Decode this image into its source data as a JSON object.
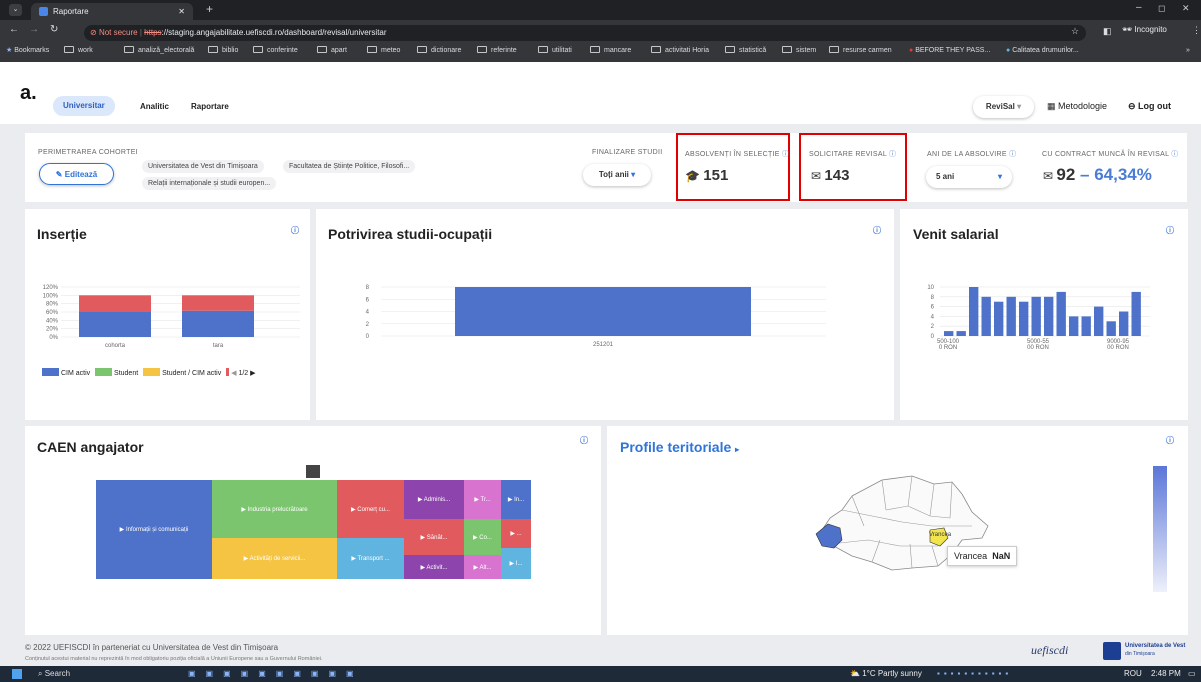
{
  "browser": {
    "tab_title": "Raportare",
    "url_warning": "Not secure",
    "url_scheme": "https",
    "url_rest": "://staging.angajabilitate.uefiscdi.ro/dashboard/revisal/universitar",
    "incognito_label": "Incognito",
    "bookmarks": [
      "Bookmarks",
      "work",
      "analiză_electorală",
      "biblio",
      "conferinte",
      "apart",
      "meteo",
      "dictionare",
      "referinte",
      "utilitati",
      "mancare",
      "activitati Horia",
      "statistică",
      "sistem",
      "resurse carmen",
      "BEFORE THEY PASS...",
      "Calitatea drumurilor..."
    ]
  },
  "nav": {
    "logo": "a.",
    "items": [
      "Universitar",
      "Analitic",
      "Raportare"
    ],
    "revisal_btn": "ReviSal",
    "metodologie": "Metodologie",
    "logout": "Log out"
  },
  "filters": {
    "cohort_title": "PERIMETRAREA COHORTEI",
    "edit_btn": "Editează",
    "tags": [
      "Universitatea de Vest din Timișoara",
      "Facultatea de Științe Politice, Filosofi...",
      "Relații internaționale și studii europen..."
    ],
    "finalizare_label": "FINALIZARE STUDII",
    "finalizare_value": "Toți anii",
    "absolventi_label": "ABSOLVENȚI ÎN SELECȚIE",
    "absolventi_value": "151",
    "solicitare_label": "SOLICITARE REVISAL",
    "solicitare_value": "143",
    "ani_label": "ANI DE LA ABSOLVIRE",
    "ani_value": "5 ani",
    "contract_label": "CU CONTRACT MUNCĂ ÎN REVISAL",
    "contract_value": "92",
    "contract_pct": "– 64,34%"
  },
  "colors": {
    "blue": "#4e71c9",
    "red": "#e05a5e",
    "green": "#7cc56f",
    "yellow": "#f5c443",
    "purple": "#8e44ad",
    "pink": "#d973d0",
    "cyan": "#5fb5e0",
    "accent": "#2f74d8"
  },
  "insertie": {
    "title": "Inserție",
    "chart_data": {
      "type": "bar",
      "stacked": true,
      "categories": [
        "cohorta",
        "tara"
      ],
      "ylim": [
        0,
        120
      ],
      "yticks": [
        "120%",
        "100%",
        "80%",
        "60%",
        "40%",
        "20%",
        "0%"
      ],
      "series": [
        {
          "name": "CIM activ",
          "values": [
            62,
            63
          ]
        },
        {
          "name": "Student",
          "values": [
            0,
            0
          ]
        },
        {
          "name": "Student / CIM activ",
          "values": [
            0,
            0
          ]
        },
        {
          "name": "",
          "values": [
            38,
            37
          ]
        }
      ]
    },
    "legend": [
      "CIM activ",
      "Student",
      "Student / CIM activ"
    ],
    "pager": "1/2"
  },
  "potrivire": {
    "title": "Potrivirea studii-ocupații",
    "chart_data": {
      "type": "bar",
      "categories": [
        "251201"
      ],
      "values": [
        8
      ],
      "ylim": [
        0,
        8
      ],
      "yticks": [
        "8",
        "6",
        "4",
        "2",
        "0"
      ]
    }
  },
  "venit": {
    "title": "Venit salarial",
    "chart_data": {
      "type": "bar",
      "ylim": [
        0,
        10
      ],
      "yticks": [
        "10",
        "8",
        "6",
        "4",
        "2",
        "0"
      ],
      "values": [
        1,
        1,
        10,
        8,
        7,
        8,
        7,
        8,
        8,
        9,
        4,
        4,
        6,
        3,
        5,
        9
      ],
      "xticks": [
        "500-100\n0 RON",
        "5000-55\n00 RON",
        "9000-95\n00 RON"
      ]
    }
  },
  "caen": {
    "title": "CAEN angajator",
    "tiles": [
      "▶ Informații și comunicații",
      "▶ Industria prelucrătoare",
      "▶ Activități de servicii...",
      "▶ Comerț cu...",
      "▶ Transport ...",
      "▶ Adminis...",
      "▶ Sănăt...",
      "▶ Activit...",
      "▶ Tr...",
      "▶ Co...",
      "▶ Alt...",
      "▶ In...",
      "▶ ...",
      "▶ I..."
    ]
  },
  "profile": {
    "title": "Profile teritoriale",
    "map_label": "Vrancea",
    "tooltip_name": "Vrancea",
    "tooltip_value": "NaN"
  },
  "footer": {
    "copyright": "© 2022 UEFISCDI în parteneriat cu Universitatea de Vest din Timișoara",
    "disclaimer": "Conținutul acestui material nu reprezintă în mod obligatoriu poziția oficială a Uniunii Europene sau a Guvernului României.",
    "logo1": "uefiscdi",
    "logo2": "Universitatea de Vest",
    "logo2_sub": "din Timișoara"
  },
  "taskbar": {
    "search": "Search",
    "weather": "1°C Partly sunny",
    "lang": "ROU",
    "time": "2:48 PM"
  }
}
